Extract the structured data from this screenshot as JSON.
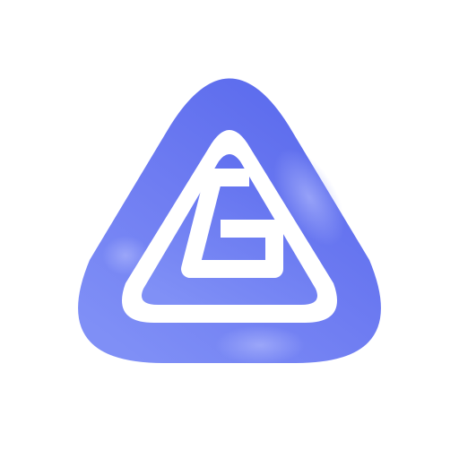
{
  "logo": {
    "icon": "triangle-g-logo-icon",
    "colors": {
      "background": "#ffffff",
      "gradient_dark": "#5868ec",
      "gradient_light": "#7f8ff6",
      "highlight": "#9aa6fa",
      "inner_mark": "#ffffff"
    }
  }
}
